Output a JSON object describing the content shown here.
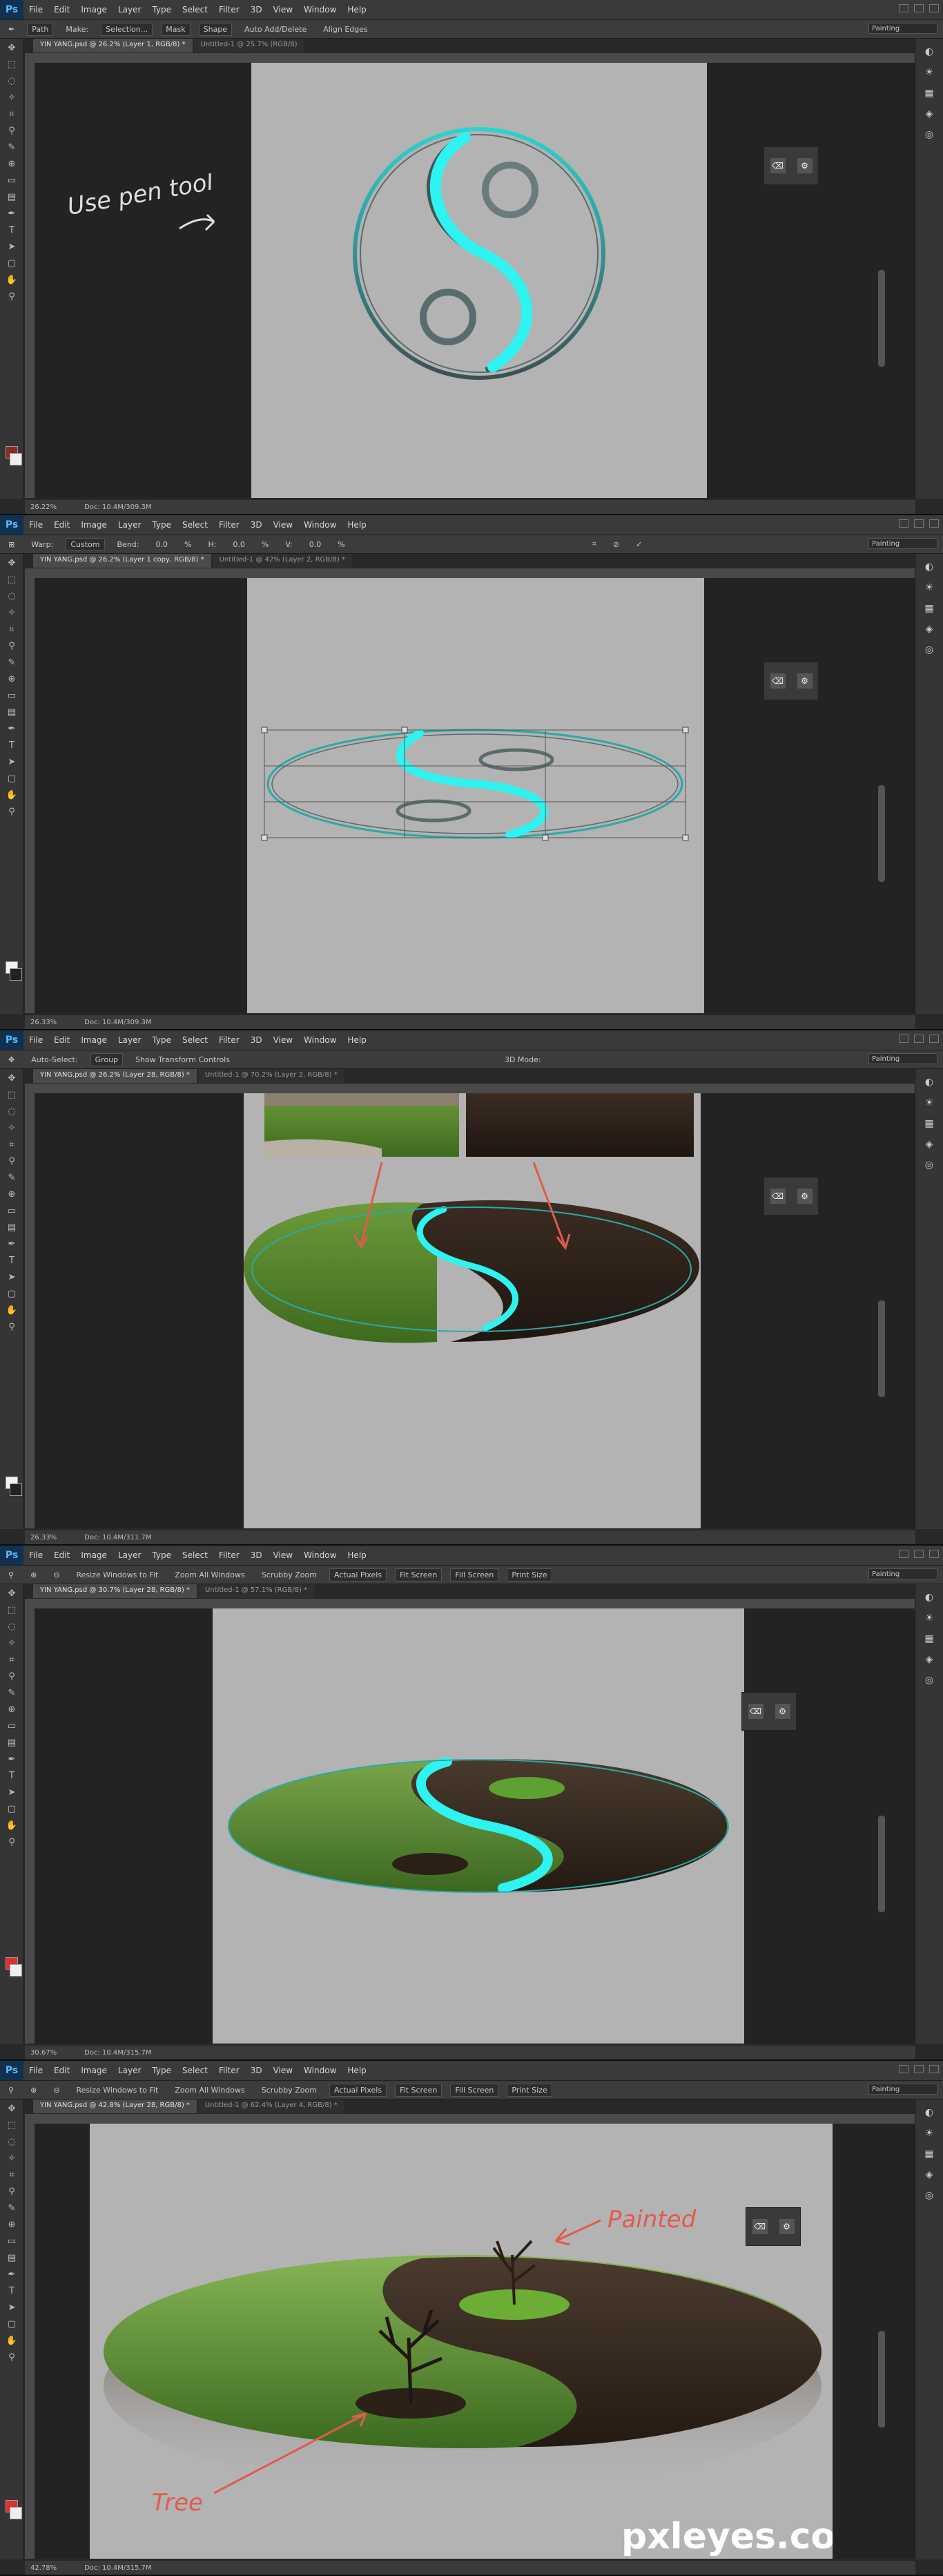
{
  "menu": [
    "File",
    "Edit",
    "Image",
    "Layer",
    "Type",
    "Select",
    "Filter",
    "3D",
    "View",
    "Window",
    "Help"
  ],
  "workspace": "Painting",
  "watermark": "pxleyes.com",
  "panels": [
    {
      "options": [
        "Path",
        "Make:",
        "Selection...",
        "Mask",
        "Shape",
        "Auto Add/Delete",
        "Align Edges"
      ],
      "tabs": [
        "YIN YANG.psd @ 26.2% (Layer 1, RGB/8) *",
        "Untitled-1 @ 25.7% (RGB/8)"
      ],
      "zoom": "26.22%",
      "doc": "Doc: 10.4M/309.3M",
      "annotation": "Use pen tool"
    },
    {
      "options": [
        "Warp:",
        "Custom",
        "Bend:",
        "0.0",
        "%",
        "H:",
        "0.0",
        "%",
        "V:",
        "0.0",
        "%"
      ],
      "tabs": [
        "YIN YANG.psd @ 26.2% (Layer 1 copy, RGB/8) *",
        "Untitled-1 @ 42% (Layer 2, RGB/8) *"
      ],
      "zoom": "26.33%",
      "doc": "Doc: 10.4M/309.3M"
    },
    {
      "options": [
        "Auto-Select:",
        "Group",
        "Show Transform Controls",
        "3D Mode:"
      ],
      "tabs": [
        "YIN YANG.psd @ 26.2% (Layer 28, RGB/8) *",
        "Untitled-1 @ 70.2% (Layer 2, RGB/8) *"
      ],
      "zoom": "26.33%",
      "doc": "Doc: 10.4M/311.7M"
    },
    {
      "options": [
        "Resize Windows to Fit",
        "Zoom All Windows",
        "Scrubby Zoom",
        "Actual Pixels",
        "Fit Screen",
        "Fill Screen",
        "Print Size"
      ],
      "tabs": [
        "YIN YANG.psd @ 30.7% (Layer 28, RGB/8) *",
        "Untitled-1 @ 57.1% (RGB/8) *"
      ],
      "zoom": "30.67%",
      "doc": "Doc: 10.4M/315.7M"
    },
    {
      "options": [
        "Resize Windows to Fit",
        "Zoom All Windows",
        "Scrubby Zoom",
        "Actual Pixels",
        "Fit Screen",
        "Fill Screen",
        "Print Size"
      ],
      "tabs": [
        "YIN YANG.psd @ 42.8% (Layer 28, RGB/8) *",
        "Untitled-1 @ 62.4% (Layer 4, RGB/8) *"
      ],
      "zoom": "42.78%",
      "doc": "Doc: 10.4M/315.7M",
      "annotation_top": "Painted",
      "annotation_bottom": "Tree"
    }
  ]
}
